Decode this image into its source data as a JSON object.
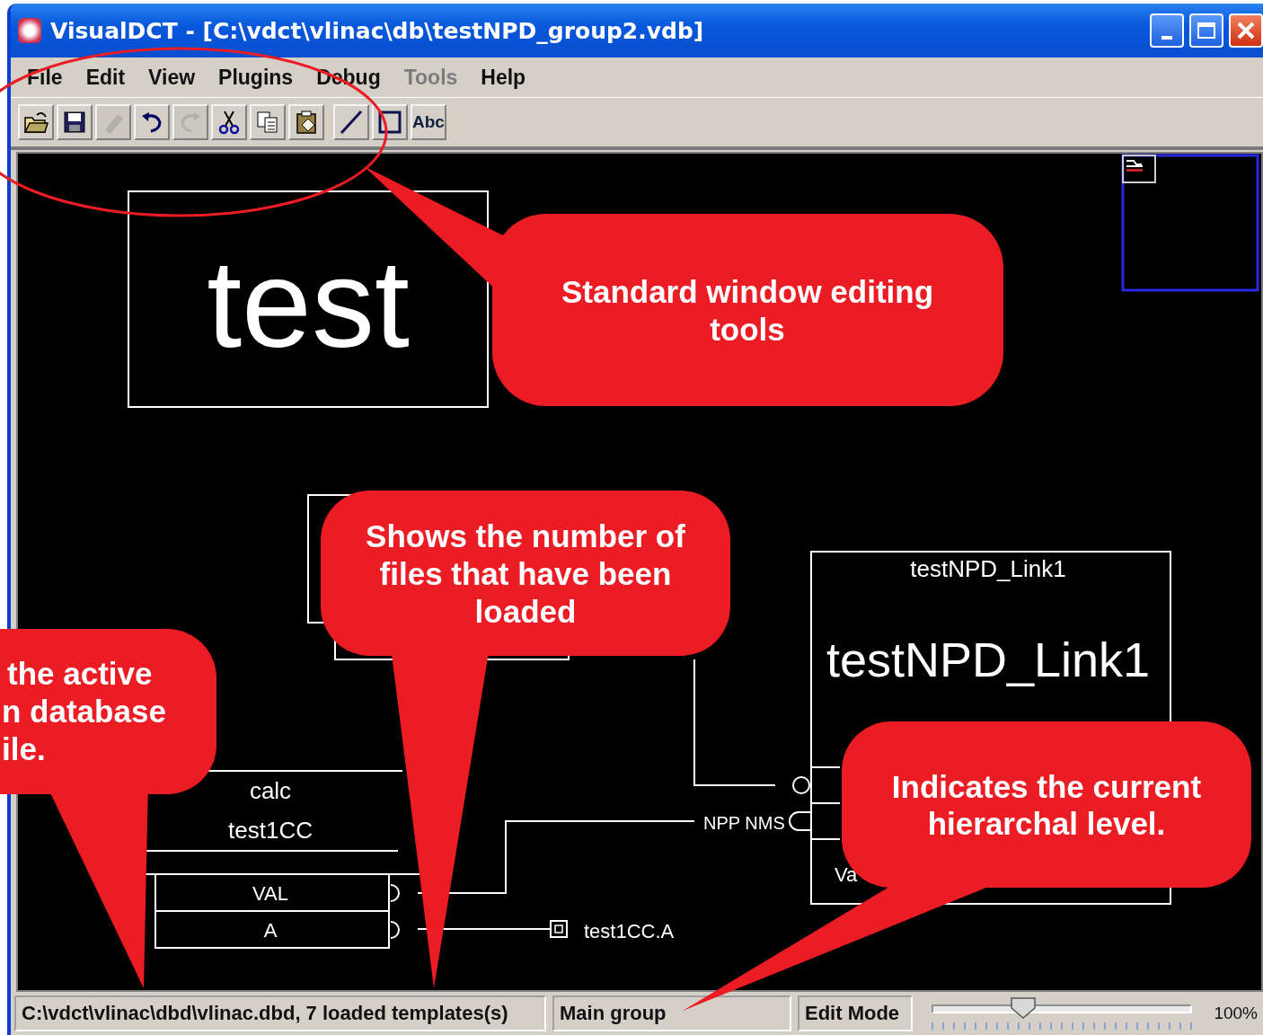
{
  "window": {
    "title": "VisualDCT - [C:\\vdct\\vlinac\\db\\testNPD_group2.vdb]"
  },
  "menu": [
    {
      "label": "File",
      "disabled": false
    },
    {
      "label": "Edit",
      "disabled": false
    },
    {
      "label": "View",
      "disabled": false
    },
    {
      "label": "Plugins",
      "disabled": false
    },
    {
      "label": "Debug",
      "disabled": false
    },
    {
      "label": "Tools",
      "disabled": true
    },
    {
      "label": "Help",
      "disabled": false
    }
  ],
  "toolbar": [
    [
      {
        "kind": "open",
        "disabled": false
      },
      {
        "kind": "save",
        "disabled": false
      },
      {
        "kind": "pen",
        "disabled": true
      },
      {
        "kind": "undo",
        "disabled": false
      },
      {
        "kind": "redo",
        "disabled": true
      },
      {
        "kind": "cut",
        "disabled": false
      },
      {
        "kind": "copy",
        "disabled": false
      },
      {
        "kind": "paste",
        "disabled": false
      }
    ],
    [
      {
        "kind": "line",
        "disabled": false
      },
      {
        "kind": "box",
        "disabled": false
      },
      {
        "kind": "text",
        "label": "Abc",
        "disabled": false
      }
    ]
  ],
  "canvas": {
    "text_box": "test",
    "calc_record": {
      "type": "calc",
      "name": "test1CC",
      "fields": [
        "VAL",
        "A"
      ]
    },
    "link_record": {
      "title": "testNPD_Link1",
      "name": "testNPD_Link1",
      "field": "Va"
    },
    "link_labels": [
      "NPP NMS",
      "test1CC.A"
    ]
  },
  "status_bar": {
    "file_info": "C:\\vdct\\vlinac\\dbd\\vlinac.dbd, 7 loaded templates(s)",
    "group": "Main group",
    "mode": "Edit Mode",
    "zoom": {
      "level": 0.35,
      "reading": "100%"
    }
  },
  "callouts": [
    {
      "lines": [
        "Standard window editing",
        "tools"
      ]
    },
    {
      "lines": [
        "Shows the number of",
        "files that have been",
        "loaded"
      ]
    },
    {
      "lines": [
        "the active",
        "n database",
        "ile."
      ]
    },
    {
      "lines": [
        "Indicates the current",
        "hierarchal level."
      ]
    }
  ]
}
